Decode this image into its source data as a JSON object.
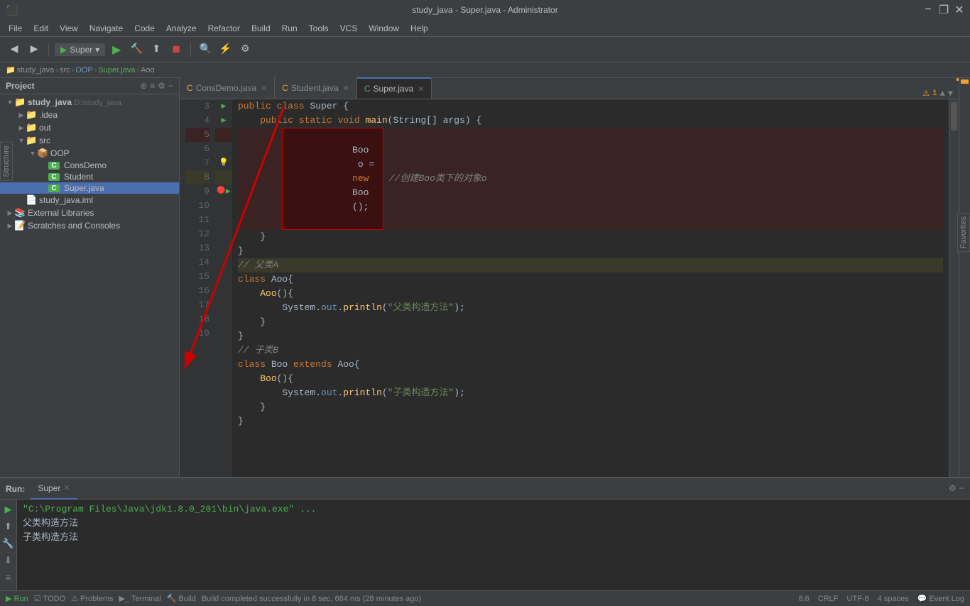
{
  "titleBar": {
    "title": "study_java - Super.java - Administrator",
    "appName": "study_java",
    "minimize": "−",
    "maximize": "❐",
    "close": "✕"
  },
  "menuBar": {
    "items": [
      "File",
      "Edit",
      "View",
      "Navigate",
      "Code",
      "Analyze",
      "Refactor",
      "Build",
      "Run",
      "Tools",
      "VCS",
      "Window",
      "Help"
    ]
  },
  "toolbar": {
    "runConfig": "Super",
    "buttons": [
      "←",
      "→",
      "↑",
      "↓"
    ]
  },
  "breadcrumb": {
    "items": [
      "study_java",
      "src",
      "OOP",
      "Super.java",
      "Aoo"
    ]
  },
  "tabs": [
    {
      "label": "ConsDemo.java",
      "type": "java",
      "active": false
    },
    {
      "label": "Student.java",
      "type": "java",
      "active": false
    },
    {
      "label": "Super.java",
      "type": "java",
      "active": true
    }
  ],
  "projectPanel": {
    "title": "Project",
    "items": [
      {
        "label": "study_java",
        "indent": 0,
        "type": "root",
        "path": "D:\\study_java",
        "expanded": true
      },
      {
        "label": ".idea",
        "indent": 1,
        "type": "folder",
        "expanded": false
      },
      {
        "label": "out",
        "indent": 1,
        "type": "folder",
        "expanded": false
      },
      {
        "label": "src",
        "indent": 1,
        "type": "folder",
        "expanded": true
      },
      {
        "label": "OOP",
        "indent": 2,
        "type": "package",
        "expanded": true
      },
      {
        "label": "ConsDemo",
        "indent": 3,
        "type": "java",
        "icon": "C"
      },
      {
        "label": "Student",
        "indent": 3,
        "type": "java",
        "icon": "C"
      },
      {
        "label": "Super.java",
        "indent": 3,
        "type": "java",
        "icon": "C",
        "selected": true
      },
      {
        "label": "study_java.iml",
        "indent": 1,
        "type": "iml"
      },
      {
        "label": "External Libraries",
        "indent": 0,
        "type": "ext"
      },
      {
        "label": "Scratches and Consoles",
        "indent": 0,
        "type": "scratch"
      }
    ]
  },
  "codeLines": [
    {
      "num": 3,
      "code": "public class Super {",
      "type": "normal"
    },
    {
      "num": 4,
      "code": "    public static void main(String[] args) {",
      "type": "normal"
    },
    {
      "num": 5,
      "code": "        Boo o = new Boo(); //创建Boo类下的对象o",
      "type": "error"
    },
    {
      "num": 6,
      "code": "    }",
      "type": "normal"
    },
    {
      "num": 7,
      "code": "}",
      "type": "warn"
    },
    {
      "num": 8,
      "code": "// 父类A",
      "type": "comment-line"
    },
    {
      "num": 9,
      "code": "class Aoo{",
      "type": "breakpoint"
    },
    {
      "num": 10,
      "code": "    Aoo(){",
      "type": "normal"
    },
    {
      "num": 11,
      "code": "        System.out.println(\"父类构造方法\");",
      "type": "normal"
    },
    {
      "num": 12,
      "code": "    }",
      "type": "normal"
    },
    {
      "num": 13,
      "code": "}",
      "type": "normal"
    },
    {
      "num": 14,
      "code": "// 子类B",
      "type": "comment-line"
    },
    {
      "num": 15,
      "code": "class Boo extends Aoo{",
      "type": "normal"
    },
    {
      "num": 16,
      "code": "    Boo(){",
      "type": "normal"
    },
    {
      "num": 17,
      "code": "        System.out.println(\"子类构造方法\");",
      "type": "normal"
    },
    {
      "num": 18,
      "code": "    }",
      "type": "normal"
    },
    {
      "num": 19,
      "code": "}",
      "type": "normal"
    }
  ],
  "runPanel": {
    "tabLabel": "Run:",
    "tabName": "Super",
    "cmdLine": "\"C:\\Program Files\\Java\\jdk1.8.0_201\\bin\\java.exe\" ...",
    "outputLines": [
      "父类构造方法",
      "子类构造方法"
    ]
  },
  "statusBar": {
    "buildStatus": "Build completed successfully in 8 sec, 664 ms (28 minutes ago)",
    "position": "8:6",
    "encoding": "CRLF",
    "charset": "UTF-8",
    "indent": "4 spaces",
    "todo": "TODO",
    "problems": "Problems",
    "terminal": "Terminal",
    "build": "Build",
    "eventLog": "Event Log",
    "warnings": "1"
  },
  "verticalLabels": {
    "left": "Structure",
    "right": "Favorites"
  }
}
